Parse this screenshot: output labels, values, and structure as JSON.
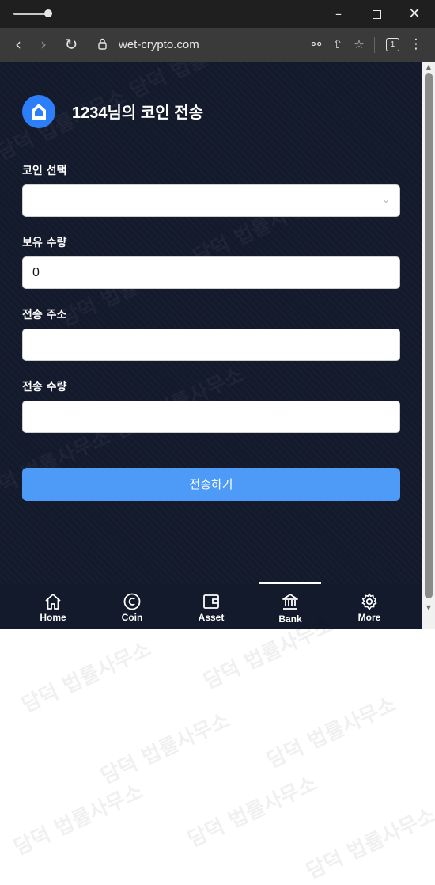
{
  "browser": {
    "url": "wet-crypto.com",
    "tab_count": "1",
    "window_controls": [
      "minimize-icon",
      "maximize-icon",
      "close-icon"
    ]
  },
  "app": {
    "title": "1234님의 코인 전송",
    "logo_icon": "house-logo-icon",
    "fields": [
      {
        "label": "코인 선택",
        "type": "select",
        "value": ""
      },
      {
        "label": "보유 수량",
        "type": "text",
        "value": "0"
      },
      {
        "label": "전송 주소",
        "type": "text",
        "value": ""
      },
      {
        "label": "전송 수량",
        "type": "text",
        "value": ""
      }
    ],
    "submit_label": "전송하기",
    "colors": {
      "background": "#131a2b",
      "accent_button": "#4d9bf6",
      "logo": "#2d7ff9"
    }
  },
  "bottom_nav": {
    "items": [
      {
        "label": "Home",
        "icon": "home-icon"
      },
      {
        "label": "Coin",
        "icon": "coin-icon"
      },
      {
        "label": "Asset",
        "icon": "wallet-icon"
      },
      {
        "label": "Bank",
        "icon": "bank-icon"
      },
      {
        "label": "More",
        "icon": "gear-icon"
      }
    ],
    "active": "Bank"
  },
  "watermark": "담덕 법률사무소"
}
